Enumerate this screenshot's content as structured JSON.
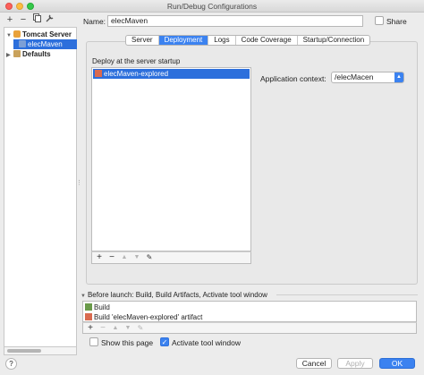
{
  "window": {
    "title": "Run/Debug Configurations"
  },
  "left_toolbar": {
    "add": "+",
    "remove": "−"
  },
  "tree": {
    "group": "Tomcat Server",
    "item": "elecMaven",
    "defaults": "Defaults"
  },
  "name": {
    "label": "Name:",
    "value": "elecMaven"
  },
  "share": {
    "label": "Share",
    "checked": false
  },
  "tabs": [
    {
      "label": "Server"
    },
    {
      "label": "Deployment"
    },
    {
      "label": "Logs"
    },
    {
      "label": "Code Coverage"
    },
    {
      "label": "Startup/Connection"
    }
  ],
  "deployment": {
    "heading": "Deploy at the server startup",
    "items": [
      "elecMaven-explored"
    ],
    "toolbar": {
      "add": "+",
      "remove": "−",
      "up": "▲",
      "down": "▼",
      "edit": "✎"
    },
    "context_label": "Application context:",
    "context_value": "/elecMacen"
  },
  "before_launch": {
    "heading": "Before launch: Build, Build Artifacts, Activate tool window",
    "items": [
      "Build",
      "Build 'elecMaven-explored' artifact"
    ],
    "toolbar": {
      "add": "+",
      "remove": "−",
      "up": "▲",
      "down": "▼",
      "edit": "✎"
    }
  },
  "options": {
    "show_page": {
      "label": "Show this page",
      "checked": false
    },
    "activate_tool": {
      "label": "Activate tool window",
      "checked": true
    }
  },
  "buttons": {
    "help": "?",
    "cancel": "Cancel",
    "apply": "Apply",
    "ok": "OK"
  },
  "colors": {
    "accent": "#3b82f0",
    "selection": "#2c6fdc"
  }
}
